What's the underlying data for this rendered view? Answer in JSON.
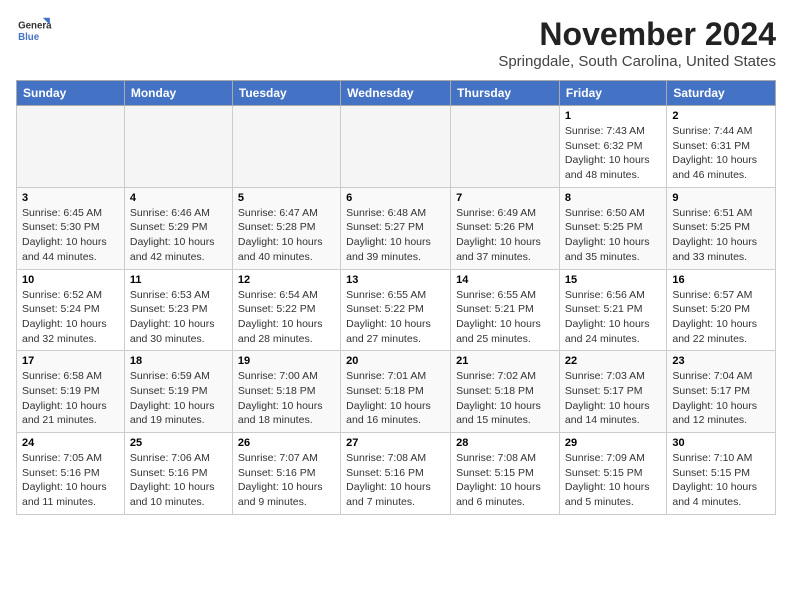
{
  "header": {
    "logo_line1": "General",
    "logo_line2": "Blue",
    "month": "November 2024",
    "location": "Springdale, South Carolina, United States"
  },
  "weekdays": [
    "Sunday",
    "Monday",
    "Tuesday",
    "Wednesday",
    "Thursday",
    "Friday",
    "Saturday"
  ],
  "weeks": [
    [
      {
        "day": "",
        "info": ""
      },
      {
        "day": "",
        "info": ""
      },
      {
        "day": "",
        "info": ""
      },
      {
        "day": "",
        "info": ""
      },
      {
        "day": "",
        "info": ""
      },
      {
        "day": "1",
        "info": "Sunrise: 7:43 AM\nSunset: 6:32 PM\nDaylight: 10 hours and 48 minutes."
      },
      {
        "day": "2",
        "info": "Sunrise: 7:44 AM\nSunset: 6:31 PM\nDaylight: 10 hours and 46 minutes."
      }
    ],
    [
      {
        "day": "3",
        "info": "Sunrise: 6:45 AM\nSunset: 5:30 PM\nDaylight: 10 hours and 44 minutes."
      },
      {
        "day": "4",
        "info": "Sunrise: 6:46 AM\nSunset: 5:29 PM\nDaylight: 10 hours and 42 minutes."
      },
      {
        "day": "5",
        "info": "Sunrise: 6:47 AM\nSunset: 5:28 PM\nDaylight: 10 hours and 40 minutes."
      },
      {
        "day": "6",
        "info": "Sunrise: 6:48 AM\nSunset: 5:27 PM\nDaylight: 10 hours and 39 minutes."
      },
      {
        "day": "7",
        "info": "Sunrise: 6:49 AM\nSunset: 5:26 PM\nDaylight: 10 hours and 37 minutes."
      },
      {
        "day": "8",
        "info": "Sunrise: 6:50 AM\nSunset: 5:25 PM\nDaylight: 10 hours and 35 minutes."
      },
      {
        "day": "9",
        "info": "Sunrise: 6:51 AM\nSunset: 5:25 PM\nDaylight: 10 hours and 33 minutes."
      }
    ],
    [
      {
        "day": "10",
        "info": "Sunrise: 6:52 AM\nSunset: 5:24 PM\nDaylight: 10 hours and 32 minutes."
      },
      {
        "day": "11",
        "info": "Sunrise: 6:53 AM\nSunset: 5:23 PM\nDaylight: 10 hours and 30 minutes."
      },
      {
        "day": "12",
        "info": "Sunrise: 6:54 AM\nSunset: 5:22 PM\nDaylight: 10 hours and 28 minutes."
      },
      {
        "day": "13",
        "info": "Sunrise: 6:55 AM\nSunset: 5:22 PM\nDaylight: 10 hours and 27 minutes."
      },
      {
        "day": "14",
        "info": "Sunrise: 6:55 AM\nSunset: 5:21 PM\nDaylight: 10 hours and 25 minutes."
      },
      {
        "day": "15",
        "info": "Sunrise: 6:56 AM\nSunset: 5:21 PM\nDaylight: 10 hours and 24 minutes."
      },
      {
        "day": "16",
        "info": "Sunrise: 6:57 AM\nSunset: 5:20 PM\nDaylight: 10 hours and 22 minutes."
      }
    ],
    [
      {
        "day": "17",
        "info": "Sunrise: 6:58 AM\nSunset: 5:19 PM\nDaylight: 10 hours and 21 minutes."
      },
      {
        "day": "18",
        "info": "Sunrise: 6:59 AM\nSunset: 5:19 PM\nDaylight: 10 hours and 19 minutes."
      },
      {
        "day": "19",
        "info": "Sunrise: 7:00 AM\nSunset: 5:18 PM\nDaylight: 10 hours and 18 minutes."
      },
      {
        "day": "20",
        "info": "Sunrise: 7:01 AM\nSunset: 5:18 PM\nDaylight: 10 hours and 16 minutes."
      },
      {
        "day": "21",
        "info": "Sunrise: 7:02 AM\nSunset: 5:18 PM\nDaylight: 10 hours and 15 minutes."
      },
      {
        "day": "22",
        "info": "Sunrise: 7:03 AM\nSunset: 5:17 PM\nDaylight: 10 hours and 14 minutes."
      },
      {
        "day": "23",
        "info": "Sunrise: 7:04 AM\nSunset: 5:17 PM\nDaylight: 10 hours and 12 minutes."
      }
    ],
    [
      {
        "day": "24",
        "info": "Sunrise: 7:05 AM\nSunset: 5:16 PM\nDaylight: 10 hours and 11 minutes."
      },
      {
        "day": "25",
        "info": "Sunrise: 7:06 AM\nSunset: 5:16 PM\nDaylight: 10 hours and 10 minutes."
      },
      {
        "day": "26",
        "info": "Sunrise: 7:07 AM\nSunset: 5:16 PM\nDaylight: 10 hours and 9 minutes."
      },
      {
        "day": "27",
        "info": "Sunrise: 7:08 AM\nSunset: 5:16 PM\nDaylight: 10 hours and 7 minutes."
      },
      {
        "day": "28",
        "info": "Sunrise: 7:08 AM\nSunset: 5:15 PM\nDaylight: 10 hours and 6 minutes."
      },
      {
        "day": "29",
        "info": "Sunrise: 7:09 AM\nSunset: 5:15 PM\nDaylight: 10 hours and 5 minutes."
      },
      {
        "day": "30",
        "info": "Sunrise: 7:10 AM\nSunset: 5:15 PM\nDaylight: 10 hours and 4 minutes."
      }
    ]
  ]
}
